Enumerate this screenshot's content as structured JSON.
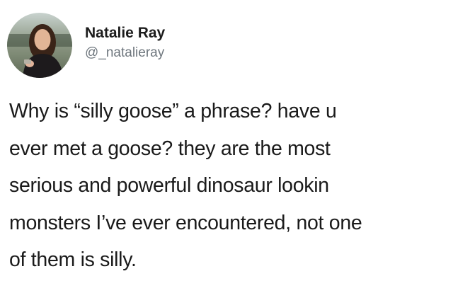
{
  "tweet": {
    "author": {
      "display_name": "Natalie Ray",
      "handle": "@_natalieray",
      "avatar_icon": "profile-photo-avatar"
    },
    "text_lines": [
      "Why is “silly goose” a phrase? have u",
      "ever met a goose? they are the most",
      "serious and powerful dinosaur lookin",
      "monsters I’ve ever encountered, not one",
      "of them is silly."
    ]
  }
}
